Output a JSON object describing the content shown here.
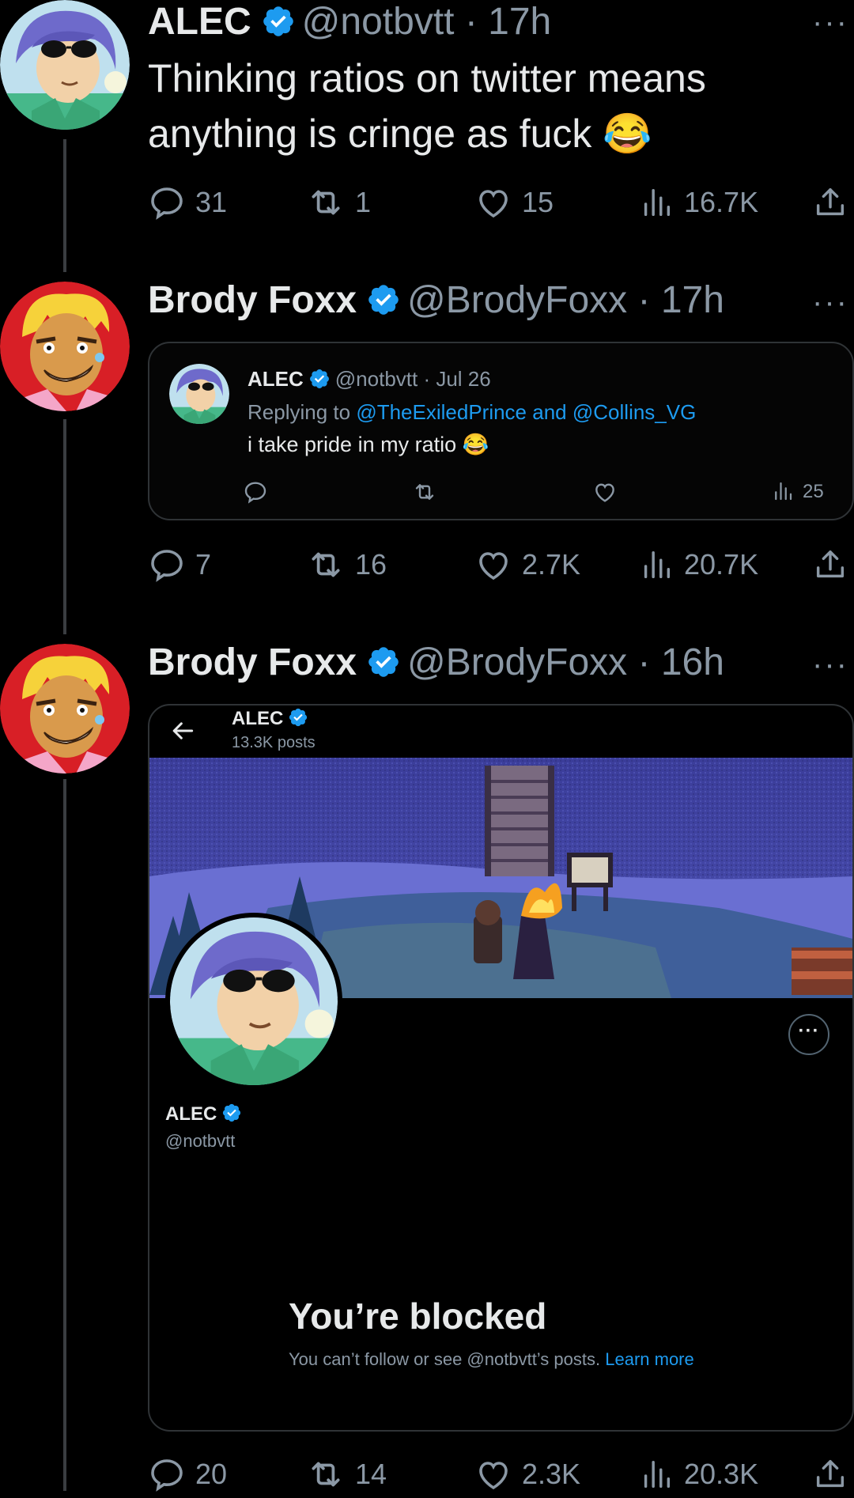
{
  "tweets": [
    {
      "name": "ALEC",
      "handle": "@notbvtt",
      "time": "17h",
      "text": "Thinking ratios on twitter means anything is cringe as fuck 😂",
      "stats": {
        "replies": "31",
        "retweets": "1",
        "likes": "15",
        "views": "16.7K"
      }
    },
    {
      "name": "Brody Foxx",
      "handle": "@BrodyFoxx",
      "time": "17h",
      "stats": {
        "replies": "7",
        "retweets": "16",
        "likes": "2.7K",
        "views": "20.7K"
      },
      "quote": {
        "name": "ALEC",
        "handle": "@notbvtt",
        "date": "Jul 26",
        "replying_prefix": "Replying to",
        "reply_user1": "@TheExiledPrince",
        "reply_and": "and",
        "reply_user2": "@Collins_VG",
        "text": "i take pride in my ratio 😂",
        "views": "25"
      }
    },
    {
      "name": "Brody Foxx",
      "handle": "@BrodyFoxx",
      "time": "16h",
      "stats": {
        "replies": "20",
        "retweets": "14",
        "likes": "2.3K",
        "views": "20.3K"
      },
      "screenshot": {
        "profile_name": "ALEC",
        "posts_count": "13.3K posts",
        "profile_handle": "@notbvtt",
        "blocked_title": "You’re blocked",
        "blocked_text": "You can’t follow or see @notbvtt’s posts.",
        "learn_more": "Learn more"
      }
    }
  ],
  "icons": {
    "more": "more-dots-icon",
    "reply": "reply-icon",
    "retweet": "retweet-icon",
    "like": "heart-icon",
    "views": "views-icon",
    "share": "share-icon",
    "verified": "verified-badge-icon",
    "back": "back-arrow-icon"
  },
  "colors": {
    "background": "#000000",
    "text": "#e7e9ea",
    "muted": "#8b98a5",
    "link": "#1d9bf0",
    "verified": "#1d9bf0"
  }
}
